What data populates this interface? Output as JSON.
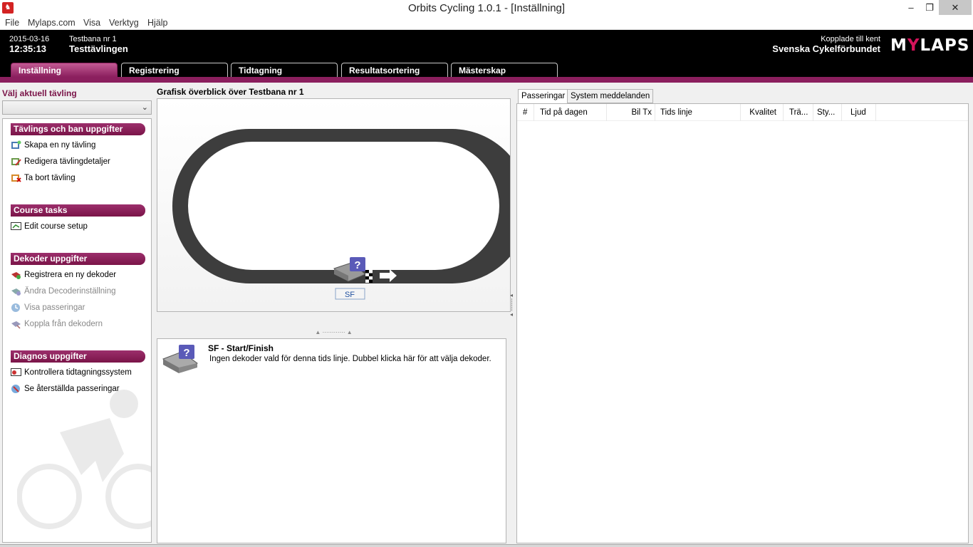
{
  "window": {
    "title": "Orbits Cycling 1.0.1  - [Inställning]",
    "app_icon": "bike-icon",
    "minimize": "–",
    "maximize": "❐",
    "close": "✕"
  },
  "menu": [
    "File",
    "Mylaps.com",
    "Visa",
    "Verktyg",
    "Hjälp"
  ],
  "header": {
    "date": "2015-03-16",
    "time": "12:35:13",
    "track": "Testbana nr 1",
    "event": "Testtävlingen",
    "connection_label": "Kopplade till kent",
    "connection_name": "Svenska Cykelförbundet",
    "logo_pre": "M",
    "logo_y": "Y",
    "logo_post": "LAPS"
  },
  "tabs": [
    "Inställning",
    "Registrering",
    "Tidtagning",
    "Resultatsortering",
    "Mästerskap"
  ],
  "active_tab": 0,
  "left": {
    "select_label": "Välj aktuell tävling",
    "select_value": "",
    "groups": [
      {
        "title": "Tävlings och ban uppgifter",
        "items": [
          {
            "label": "Skapa en ny tävling",
            "icon": "create-event-icon",
            "enabled": true
          },
          {
            "label": "Redigera tävlingdetaljer",
            "icon": "edit-event-icon",
            "enabled": true
          },
          {
            "label": "Ta bort tävling",
            "icon": "delete-event-icon",
            "enabled": true
          }
        ]
      },
      {
        "title": "Course tasks",
        "items": [
          {
            "label": "Edit course setup",
            "icon": "course-setup-icon",
            "enabled": true
          }
        ]
      },
      {
        "title": "Dekoder uppgifter",
        "items": [
          {
            "label": "Registrera en ny dekoder",
            "icon": "register-decoder-icon",
            "enabled": true
          },
          {
            "label": "Ändra Decoderinställning",
            "icon": "decoder-settings-icon",
            "enabled": false
          },
          {
            "label": "Visa passeringar",
            "icon": "passings-icon",
            "enabled": false
          },
          {
            "label": "Koppla från dekodern",
            "icon": "disconnect-decoder-icon",
            "enabled": false
          }
        ]
      },
      {
        "title": "Diagnos uppgifter",
        "items": [
          {
            "label": "Kontrollera tidtagningssystem",
            "icon": "check-timing-icon",
            "enabled": true
          },
          {
            "label": "Se återställda passeringar",
            "icon": "restored-passings-icon",
            "enabled": true
          }
        ]
      }
    ]
  },
  "center": {
    "title": "Grafisk överblick över Testbana nr 1",
    "timeline_label": "SF",
    "decoder_title": "SF - Start/Finish",
    "decoder_desc": "Ingen dekoder vald för denna tids linje. Dubbel klicka här för att välja dekoder.",
    "help_badge": "?"
  },
  "right": {
    "tabs": [
      "Passeringar",
      "System meddelanden"
    ],
    "active_tab": 0,
    "columns": [
      "#",
      "Tid på dagen",
      "Bil Tx",
      "Tids linje",
      "Kvalitet",
      "Trä...",
      "Sty...",
      "Ljud"
    ]
  },
  "colors": {
    "accent": "#8b1f5e",
    "header_bg": "#000000",
    "track": "#3d3d3d"
  }
}
